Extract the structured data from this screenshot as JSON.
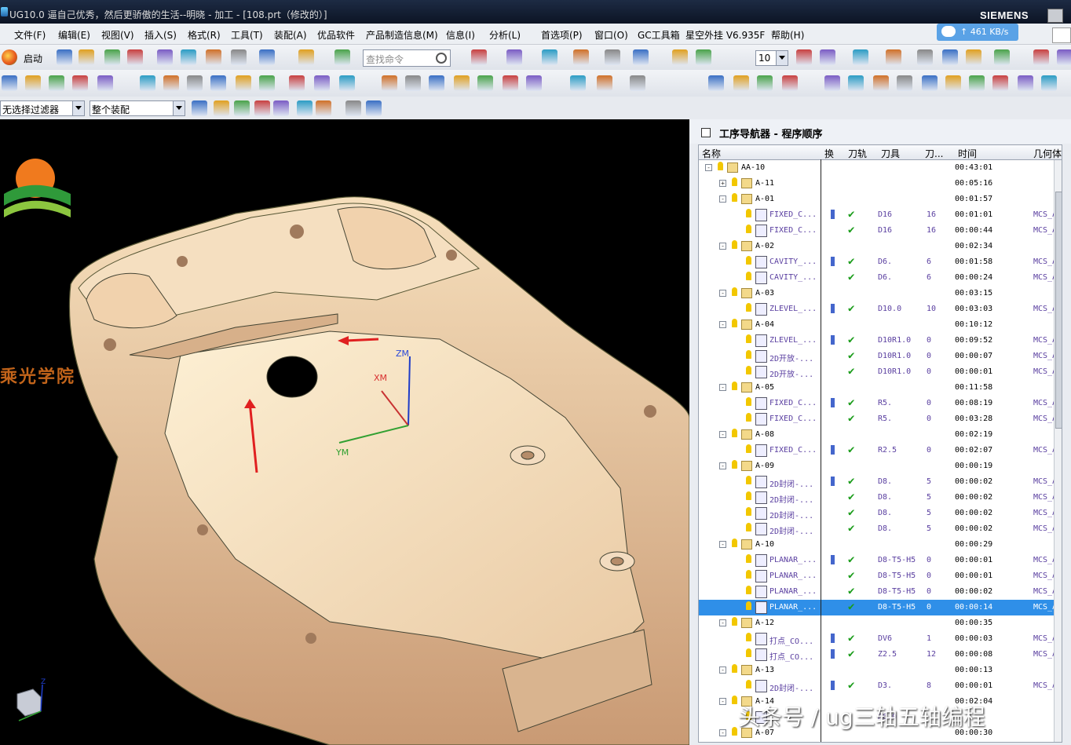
{
  "window": {
    "title": "UG10.0 逼自己优秀，然后更骄傲的生活--明晓 - 加工 - [108.prt（修改的）]",
    "brand": "SIEMENS"
  },
  "network": {
    "speed": "461 KB/s"
  },
  "menubar": {
    "items": [
      "文件(F)",
      "编辑(E)",
      "视图(V)",
      "插入(S)",
      "格式(R)",
      "工具(T)",
      "装配(A)",
      "优品软件",
      "产品制造信息(M)",
      "信息(I)",
      "分析(L)",
      "首选项(P)",
      "窗口(O)",
      "GC工具箱",
      "星空外挂 V6.935F",
      "帮助(H)"
    ]
  },
  "toolbar": {
    "start_label": "启动",
    "search_placeholder": "查找命令",
    "zoom_value": "10",
    "filter_value": "无选择过滤器",
    "assembly_value": "整个装配"
  },
  "viewport": {
    "school_name": "乘光学院",
    "axis_labels": {
      "zm": "ZM",
      "xm": "XM",
      "ym": "YM"
    },
    "triad_label": "Z"
  },
  "navigator": {
    "title": "工序导航器 - 程序顺序",
    "columns": [
      "名称",
      "换",
      "刀轨",
      "刀具",
      "刀...",
      "时间",
      "几何体"
    ],
    "rows": [
      {
        "level": 0,
        "type": "group",
        "expand": "-",
        "name": "AA-10",
        "path": false,
        "check": false,
        "tool": "",
        "tn": "",
        "time": "00:43:01",
        "geom": ""
      },
      {
        "level": 1,
        "type": "group",
        "expand": "+",
        "name": "A-11",
        "path": false,
        "check": false,
        "tool": "",
        "tn": "",
        "time": "00:05:16",
        "geom": ""
      },
      {
        "level": 1,
        "type": "group",
        "expand": "-",
        "name": "A-01",
        "path": false,
        "check": false,
        "tool": "",
        "tn": "",
        "time": "00:01:57",
        "geom": ""
      },
      {
        "level": 2,
        "type": "op",
        "expand": "",
        "name": "FIXED_C...",
        "path": true,
        "check": true,
        "tool": "D16",
        "tn": "16",
        "time": "00:01:01",
        "geom": "MCS_A"
      },
      {
        "level": 2,
        "type": "op",
        "expand": "",
        "name": "FIXED_C...",
        "path": false,
        "check": true,
        "tool": "D16",
        "tn": "16",
        "time": "00:00:44",
        "geom": "MCS_A"
      },
      {
        "level": 1,
        "type": "group",
        "expand": "-",
        "name": "A-02",
        "path": false,
        "check": false,
        "tool": "",
        "tn": "",
        "time": "00:02:34",
        "geom": ""
      },
      {
        "level": 2,
        "type": "op",
        "expand": "",
        "name": "CAVITY_...",
        "path": true,
        "check": true,
        "tool": "D6.",
        "tn": "6",
        "time": "00:01:58",
        "geom": "MCS_A"
      },
      {
        "level": 2,
        "type": "op",
        "expand": "",
        "name": "CAVITY_...",
        "path": false,
        "check": true,
        "tool": "D6.",
        "tn": "6",
        "time": "00:00:24",
        "geom": "MCS_A"
      },
      {
        "level": 1,
        "type": "group",
        "expand": "-",
        "name": "A-03",
        "path": false,
        "check": false,
        "tool": "",
        "tn": "",
        "time": "00:03:15",
        "geom": ""
      },
      {
        "level": 2,
        "type": "op",
        "expand": "",
        "name": "ZLEVEL_...",
        "path": true,
        "check": true,
        "tool": "D10.0",
        "tn": "10",
        "time": "00:03:03",
        "geom": "MCS_A"
      },
      {
        "level": 1,
        "type": "group",
        "expand": "-",
        "name": "A-04",
        "path": false,
        "check": false,
        "tool": "",
        "tn": "",
        "time": "00:10:12",
        "geom": ""
      },
      {
        "level": 2,
        "type": "op",
        "expand": "",
        "name": "ZLEVEL_...",
        "path": true,
        "check": true,
        "tool": "D10R1.0",
        "tn": "0",
        "time": "00:09:52",
        "geom": "MCS_A"
      },
      {
        "level": 2,
        "type": "op",
        "expand": "",
        "name": "2D开放-...",
        "path": false,
        "check": true,
        "tool": "D10R1.0",
        "tn": "0",
        "time": "00:00:07",
        "geom": "MCS_A"
      },
      {
        "level": 2,
        "type": "op",
        "expand": "",
        "name": "2D开放-...",
        "path": false,
        "check": true,
        "tool": "D10R1.0",
        "tn": "0",
        "time": "00:00:01",
        "geom": "MCS_A"
      },
      {
        "level": 1,
        "type": "group",
        "expand": "-",
        "name": "A-05",
        "path": false,
        "check": false,
        "tool": "",
        "tn": "",
        "time": "00:11:58",
        "geom": ""
      },
      {
        "level": 2,
        "type": "op",
        "expand": "",
        "name": "FIXED_C...",
        "path": true,
        "check": true,
        "tool": "R5.",
        "tn": "0",
        "time": "00:08:19",
        "geom": "MCS_A"
      },
      {
        "level": 2,
        "type": "op",
        "expand": "",
        "name": "FIXED_C...",
        "path": false,
        "check": true,
        "tool": "R5.",
        "tn": "0",
        "time": "00:03:28",
        "geom": "MCS_A"
      },
      {
        "level": 1,
        "type": "group",
        "expand": "-",
        "name": "A-08",
        "path": false,
        "check": false,
        "tool": "",
        "tn": "",
        "time": "00:02:19",
        "geom": ""
      },
      {
        "level": 2,
        "type": "op",
        "expand": "",
        "name": "FIXED_C...",
        "path": true,
        "check": true,
        "tool": "R2.5",
        "tn": "0",
        "time": "00:02:07",
        "geom": "MCS_A"
      },
      {
        "level": 1,
        "type": "group",
        "expand": "-",
        "name": "A-09",
        "path": false,
        "check": false,
        "tool": "",
        "tn": "",
        "time": "00:00:19",
        "geom": ""
      },
      {
        "level": 2,
        "type": "op",
        "expand": "",
        "name": "2D封闭-...",
        "path": true,
        "check": true,
        "tool": "D8.",
        "tn": "5",
        "time": "00:00:02",
        "geom": "MCS_A"
      },
      {
        "level": 2,
        "type": "op",
        "expand": "",
        "name": "2D封闭-...",
        "path": false,
        "check": true,
        "tool": "D8.",
        "tn": "5",
        "time": "00:00:02",
        "geom": "MCS_A"
      },
      {
        "level": 2,
        "type": "op",
        "expand": "",
        "name": "2D封闭-...",
        "path": false,
        "check": true,
        "tool": "D8.",
        "tn": "5",
        "time": "00:00:02",
        "geom": "MCS_A"
      },
      {
        "level": 2,
        "type": "op",
        "expand": "",
        "name": "2D封闭-...",
        "path": false,
        "check": true,
        "tool": "D8.",
        "tn": "5",
        "time": "00:00:02",
        "geom": "MCS_A"
      },
      {
        "level": 1,
        "type": "group",
        "expand": "-",
        "name": "A-10",
        "path": false,
        "check": false,
        "tool": "",
        "tn": "",
        "time": "00:00:29",
        "geom": ""
      },
      {
        "level": 2,
        "type": "op",
        "expand": "",
        "name": "PLANAR_...",
        "path": true,
        "check": true,
        "tool": "D8-T5-H5",
        "tn": "0",
        "time": "00:00:01",
        "geom": "MCS_A"
      },
      {
        "level": 2,
        "type": "op",
        "expand": "",
        "name": "PLANAR_...",
        "path": false,
        "check": true,
        "tool": "D8-T5-H5",
        "tn": "0",
        "time": "00:00:01",
        "geom": "MCS_A"
      },
      {
        "level": 2,
        "type": "op",
        "expand": "",
        "name": "PLANAR_...",
        "path": false,
        "check": true,
        "tool": "D8-T5-H5",
        "tn": "0",
        "time": "00:00:02",
        "geom": "MCS_A"
      },
      {
        "level": 2,
        "type": "op",
        "expand": "",
        "name": "PLANAR_...",
        "path": false,
        "check": true,
        "tool": "D8-T5-H5",
        "tn": "0",
        "time": "00:00:14",
        "geom": "MCS_A",
        "selected": true
      },
      {
        "level": 1,
        "type": "group",
        "expand": "-",
        "name": "A-12",
        "path": false,
        "check": false,
        "tool": "",
        "tn": "",
        "time": "00:00:35",
        "geom": ""
      },
      {
        "level": 2,
        "type": "op",
        "expand": "",
        "name": "打点_CO...",
        "path": true,
        "check": true,
        "tool": "DV6",
        "tn": "1",
        "time": "00:00:03",
        "geom": "MCS_A"
      },
      {
        "level": 2,
        "type": "op",
        "expand": "",
        "name": "打点_CO...",
        "path": true,
        "check": true,
        "tool": "Z2.5",
        "tn": "12",
        "time": "00:00:08",
        "geom": "MCS_A"
      },
      {
        "level": 1,
        "type": "group",
        "expand": "-",
        "name": "A-13",
        "path": false,
        "check": false,
        "tool": "",
        "tn": "",
        "time": "00:00:13",
        "geom": ""
      },
      {
        "level": 2,
        "type": "op",
        "expand": "",
        "name": "2D封闭-...",
        "path": true,
        "check": true,
        "tool": "D3.",
        "tn": "8",
        "time": "00:00:01",
        "geom": "MCS_A"
      },
      {
        "level": 1,
        "type": "group",
        "expand": "-",
        "name": "A-14",
        "path": false,
        "check": false,
        "tool": "",
        "tn": "",
        "time": "00:02:04",
        "geom": ""
      },
      {
        "level": 2,
        "type": "op",
        "expand": "",
        "name": "",
        "path": false,
        "check": false,
        "tool": "R6.0",
        "tn": "",
        "time": "",
        "geom": ""
      },
      {
        "level": 1,
        "type": "group",
        "expand": "-",
        "name": "A-07",
        "path": false,
        "check": false,
        "tool": "",
        "tn": "",
        "time": "00:00:30",
        "geom": ""
      }
    ]
  },
  "watermark": "头条号 / ug三轴五轴编程"
}
